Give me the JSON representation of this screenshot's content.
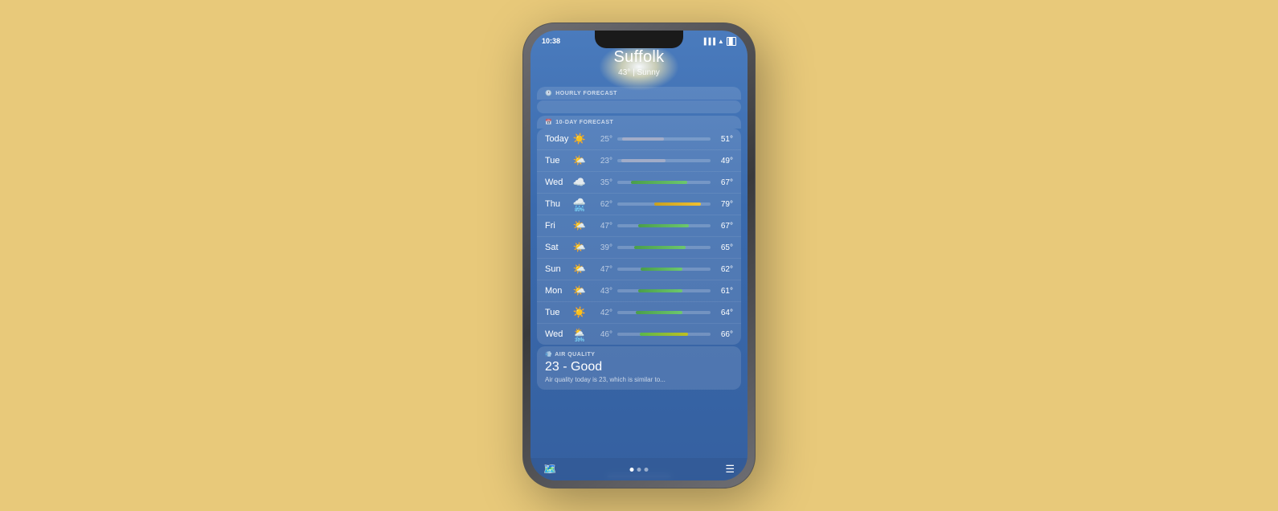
{
  "background_color": "#E8C97A",
  "phone": {
    "status_bar": {
      "time": "10:38",
      "icons": "signal wifi battery"
    },
    "header": {
      "city": "Suffolk",
      "temp": "43°",
      "condition": "Sunny",
      "temp_condition_label": "43° | Sunny"
    },
    "sections": {
      "hourly_label": "HOURLY FORECAST",
      "tenday_label": "10-DAY FORECAST"
    },
    "forecast": [
      {
        "day": "Today",
        "icon": "☀️",
        "low": "25°",
        "high": "51°",
        "bar_type": "gray",
        "bar_left": "5%",
        "bar_width": "45%",
        "precip": ""
      },
      {
        "day": "Tue",
        "icon": "🌤️",
        "low": "23°",
        "high": "49°",
        "bar_type": "gray",
        "bar_left": "4%",
        "bar_width": "48%",
        "precip": ""
      },
      {
        "day": "Wed",
        "icon": "☁️",
        "low": "35°",
        "high": "67°",
        "bar_type": "green",
        "bar_left": "15%",
        "bar_width": "60%",
        "precip": ""
      },
      {
        "day": "Thu",
        "icon": "🌧️",
        "low": "62°",
        "high": "79°",
        "bar_type": "yellow",
        "bar_left": "40%",
        "bar_width": "50%",
        "precip": "80%"
      },
      {
        "day": "Fri",
        "icon": "🌤️",
        "low": "47°",
        "high": "67°",
        "bar_type": "green",
        "bar_left": "22%",
        "bar_width": "55%",
        "precip": ""
      },
      {
        "day": "Sat",
        "icon": "🌤️",
        "low": "39°",
        "high": "65°",
        "bar_type": "green",
        "bar_left": "18%",
        "bar_width": "55%",
        "precip": ""
      },
      {
        "day": "Sun",
        "icon": "🌤️",
        "low": "47°",
        "high": "62°",
        "bar_type": "green",
        "bar_left": "25%",
        "bar_width": "45%",
        "precip": ""
      },
      {
        "day": "Mon",
        "icon": "🌤️",
        "low": "43°",
        "high": "61°",
        "bar_type": "green",
        "bar_left": "22%",
        "bar_width": "48%",
        "precip": ""
      },
      {
        "day": "Tue",
        "icon": "☀️",
        "low": "42°",
        "high": "64°",
        "bar_type": "green",
        "bar_left": "20%",
        "bar_width": "50%",
        "precip": ""
      },
      {
        "day": "Wed",
        "icon": "🌦️",
        "low": "46°",
        "high": "66°",
        "bar_type": "green-yellow",
        "bar_left": "24%",
        "bar_width": "52%",
        "precip": "30%"
      }
    ],
    "air_quality": {
      "label": "AIR QUALITY",
      "value": "23 - Good",
      "description": "Air quality today is 23, which is similar to..."
    },
    "bottom_dots": [
      "active",
      "inactive",
      "inactive"
    ],
    "bottom_icons": {
      "left": "map",
      "right": "list"
    }
  }
}
